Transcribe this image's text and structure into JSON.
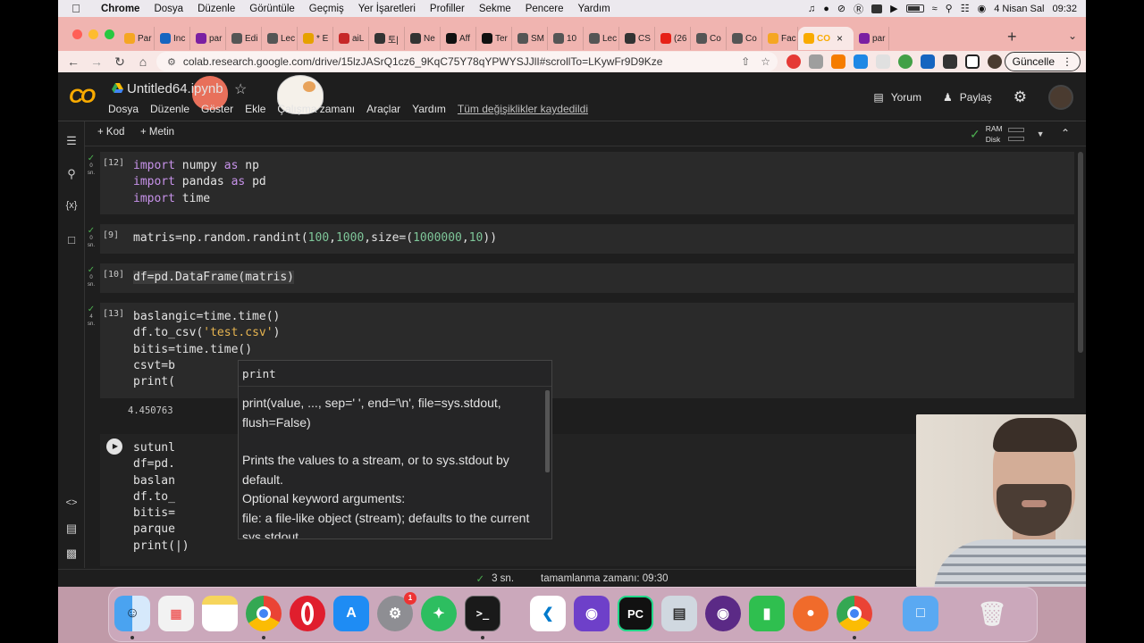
{
  "menubar": {
    "app": "Chrome",
    "items": [
      "Dosya",
      "Düzenle",
      "Görüntüle",
      "Geçmiş",
      "Yer İşaretleri",
      "Profiller",
      "Sekme",
      "Pencere",
      "Yardım"
    ],
    "date": "4 Nisan Sal",
    "time": "09:32"
  },
  "tabs": [
    {
      "label": "Par",
      "favicon_color": "#f5a623"
    },
    {
      "label": "Inc",
      "favicon_color": "#1565c0"
    },
    {
      "label": "par",
      "favicon_color": "#7b1fa2"
    },
    {
      "label": "Edi",
      "favicon_color": "#555555"
    },
    {
      "label": "Lec",
      "favicon_color": "#555555"
    },
    {
      "label": "* E",
      "favicon_color": "#e6a100"
    },
    {
      "label": "aiL",
      "favicon_color": "#c62828"
    },
    {
      "label": "토|",
      "favicon_color": "#333333"
    },
    {
      "label": "Ne",
      "favicon_color": "#333333"
    },
    {
      "label": "Aff",
      "favicon_color": "#111111"
    },
    {
      "label": "Ter",
      "favicon_color": "#111111"
    },
    {
      "label": "SM",
      "favicon_color": "#555555"
    },
    {
      "label": "10",
      "favicon_color": "#555555"
    },
    {
      "label": "Lec",
      "favicon_color": "#555555"
    },
    {
      "label": "CS",
      "favicon_color": "#333333"
    },
    {
      "label": "(26",
      "favicon_color": "#e62117"
    },
    {
      "label": "Co",
      "favicon_color": "#555555"
    },
    {
      "label": "Co",
      "favicon_color": "#555555"
    },
    {
      "label": "Fac",
      "favicon_color": "#f5a623"
    }
  ],
  "active_tab": {
    "label": "CO",
    "favicon_color": "#f9ab00"
  },
  "after_tab": {
    "label": "par",
    "favicon_color": "#7b1fa2"
  },
  "url": "colab.research.google.com/drive/15lzJASrQ1cz6_9KqC75Y78qYPWYSJJlI#scrollTo=LKywFr9D9Kze",
  "update_button": "Güncelle",
  "colab": {
    "logo": "CO",
    "title": "Untitled64.ipynb",
    "menu": [
      "Dosya",
      "Düzenle",
      "Göster",
      "Ekle",
      "Çalışma zamanı",
      "Araçlar",
      "Yardım"
    ],
    "saved_status": "Tüm değişiklikler kaydedildi",
    "comment": "Yorum",
    "share": "Paylaş"
  },
  "toolbar": {
    "add_code": "Kod",
    "add_text": "Metin",
    "ram": "RAM",
    "disk": "Disk"
  },
  "cells": [
    {
      "exec": "[12]",
      "time": "0",
      "unit": "sn.",
      "lines": [
        "import numpy as np",
        "import pandas as pd",
        "import time"
      ]
    },
    {
      "exec": "[9]",
      "time": "0",
      "unit": "sn.",
      "lines": [
        "matris=np.random.randint(100,1000,size=(1000000,10))"
      ]
    },
    {
      "exec": "[10]",
      "time": "0",
      "unit": "sn.",
      "lines": [
        "df=pd.DataFrame(matris)"
      ]
    },
    {
      "exec": "[13]",
      "time": "4",
      "unit": "sn.",
      "lines": [
        "baslangic=time.time()",
        "df.to_csv('test.csv')",
        "bitis=time.time()",
        "csvt=b",
        "print("
      ],
      "output": "4.450763"
    },
    {
      "exec": "",
      "lines": [
        "sutunl",
        "df=pd.",
        "baslan",
        "df.to_",
        "bitis=",
        "parque",
        "print(|)"
      ]
    }
  ],
  "tooltip": {
    "name": "print",
    "signature": "print(value, ..., sep=' ', end='\\n', file=sys.stdout, flush=False)",
    "description": "Prints the values to a stream, or to sys.stdout by default.",
    "args_header": "Optional keyword arguments:",
    "arg_file": "file:  a file-like object (stream); defaults to the current sys.stdout."
  },
  "statusbar": {
    "time": "3 sn.",
    "completed": "tamamlanma zamanı: 09:30"
  },
  "dock": {
    "notification_badge": "1"
  }
}
